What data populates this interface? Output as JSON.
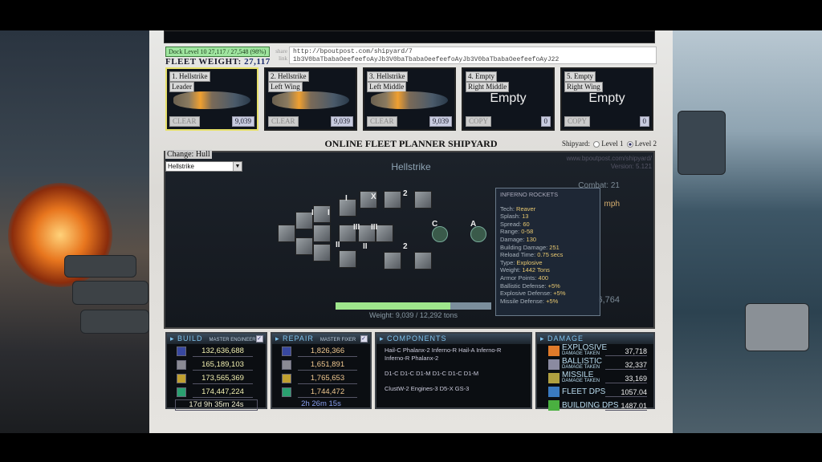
{
  "fleet": {
    "dock_level": "Dock Level 10 27,117 / 27,548 (98%)",
    "weight_label": "FLEET WEIGHT:",
    "weight_value": "27,117",
    "share_label": "share link",
    "share_url_line1": "http://bpoutpost.com/shipyard/7",
    "share_url_line2": "1b3V0baTbabaOeefeefoAyJb3V0baTbabaOeefeefoAyJb3V0baTbabaOeefeefoAyJ22"
  },
  "slots": [
    {
      "name": "1. Hellstrike",
      "position": "Leader",
      "button": "CLEAR",
      "weight": "9,039",
      "empty": false,
      "selected": true
    },
    {
      "name": "2. Hellstrike",
      "position": "Left Wing",
      "button": "CLEAR",
      "weight": "9,039",
      "empty": false
    },
    {
      "name": "3. Hellstrike",
      "position": "Left Middle",
      "button": "CLEAR",
      "weight": "9,039",
      "empty": false
    },
    {
      "name": "4. Empty",
      "position": "Right Middle",
      "button": "COPY",
      "weight": "0",
      "empty": true,
      "empty_text": "Empty"
    },
    {
      "name": "5. Empty",
      "position": "Right Wing",
      "button": "COPY",
      "weight": "0",
      "empty": true,
      "empty_text": "Empty"
    }
  ],
  "title": "ONLINE FLEET PLANNER SHIPYARD",
  "shipyard": {
    "label": "Shipyard:",
    "options": [
      "Level 1",
      "Level 2"
    ],
    "selected": "Level 2"
  },
  "hull": {
    "change_label": "Change: Hull",
    "selected": "Hellstrike",
    "title": "Hellstrike",
    "site": "www.bpoutpost.com/shipyard/",
    "version": "Version: 5.121",
    "module_labels": [
      "I",
      "I",
      "I",
      "II",
      "II",
      "III",
      "III",
      "X",
      "2",
      "2",
      "C",
      "A"
    ],
    "weight_text": "Weight: 9,039 / 12,292 tons",
    "weight_current": 9039,
    "weight_max": 12292,
    "stats_visible": [
      "Combat: 21",
      "mph",
      "6,764"
    ]
  },
  "tooltip": {
    "title": "INFERNO ROCKETS",
    "lines": [
      {
        "k": "Tech:",
        "v": "Reaver"
      },
      {
        "k": "Splash:",
        "v": "13"
      },
      {
        "k": "Spread:",
        "v": "60"
      },
      {
        "k": "Range:",
        "v": "0-58"
      },
      {
        "k": "Damage:",
        "v": "130"
      },
      {
        "k": "Building Damage:",
        "v": "251"
      },
      {
        "k": "Reload Time:",
        "v": "0.75 secs"
      },
      {
        "k": "Type:",
        "v": "Explosive"
      },
      {
        "k": "Weight:",
        "v": "1442 Tons"
      },
      {
        "k": "Armor Points:",
        "v": "400"
      },
      {
        "k": "Ballistic Defense:",
        "v": "+5%"
      },
      {
        "k": "Explosive Defense:",
        "v": "+5%"
      },
      {
        "k": "Missile Defense:",
        "v": "+5%"
      }
    ]
  },
  "build": {
    "title": "BUILD",
    "sub": "MASTER ENGINEER",
    "values": [
      "132,636,688",
      "165,189,103",
      "173,565,369",
      "174,447,224"
    ],
    "time": "17d 9h 35m 24s"
  },
  "repair": {
    "title": "REPAIR",
    "sub": "MASTER FIXER",
    "values": [
      "1,826,366",
      "1,651,891",
      "1,765,653",
      "1,744,472"
    ],
    "time": "2h 26m 15s"
  },
  "components": {
    "title": "COMPONENTS",
    "lines": [
      "Hail-C Phalanx-2 Inferno-R Hail-A Inferno-R Inferno-R Phalanx-2",
      "D1-C D1-C D1-M D1-C D1-C D1-M",
      "ClustW-2 Engines-3 D5-X GS-3"
    ]
  },
  "damage": {
    "title": "DAMAGE",
    "rows": [
      {
        "label": "EXPLOSIVE",
        "sub": "DAMAGE TAKEN",
        "value": "37,718",
        "color": "#e07a2a"
      },
      {
        "label": "BALLISTIC",
        "sub": "DAMAGE TAKEN",
        "value": "32,337",
        "color": "#8a8aa0"
      },
      {
        "label": "MISSILE",
        "sub": "DAMAGE TAKEN",
        "value": "33,169",
        "color": "#b0a040"
      },
      {
        "label": "FLEET DPS",
        "sub": "",
        "value": "1057.04",
        "color": "#3a7ac0"
      },
      {
        "label": "BUILDING DPS",
        "sub": "",
        "value": "1487.01",
        "color": "#4ab040"
      }
    ]
  },
  "resource_icons": [
    "command-icon",
    "metal-icon",
    "energy-icon",
    "crystal-icon"
  ],
  "resource_colors": [
    "#3848a0",
    "#8a8a94",
    "#c0a030",
    "#2aa070"
  ],
  "colors": {
    "build_value": "#f2f0b0",
    "repair_value": "#f0c890",
    "repair_time": "#8aa0f0",
    "weight_fill": "#9ee58c"
  }
}
